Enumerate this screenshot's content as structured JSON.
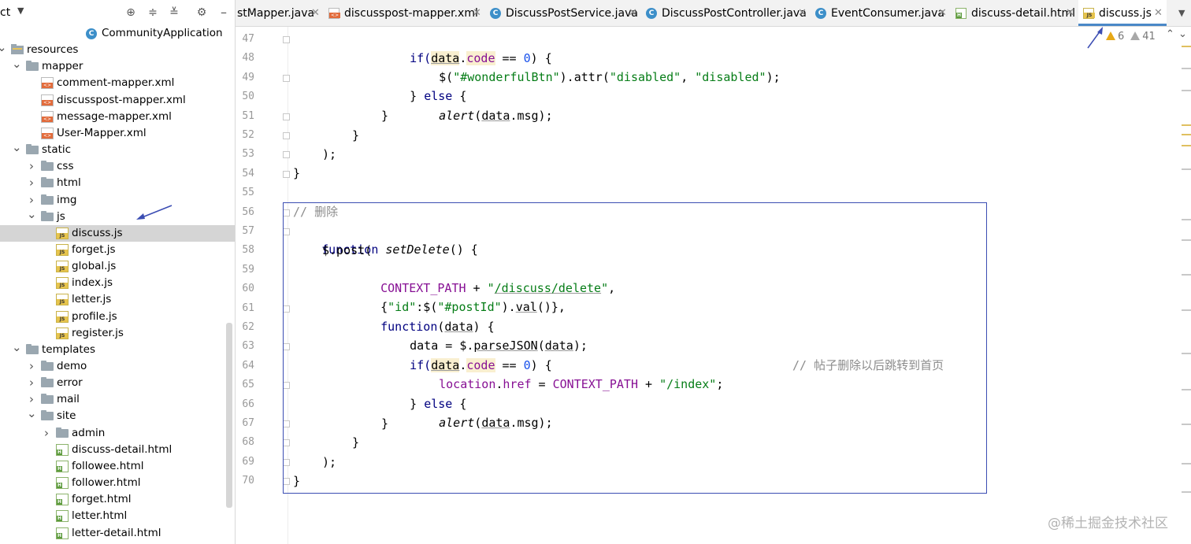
{
  "project_panel": {
    "title": "ct",
    "items": [
      {
        "label": "CommunityApplication",
        "type": "app",
        "depth": 5,
        "arrow": ""
      },
      {
        "label": "resources",
        "type": "resources",
        "depth": 0,
        "arrow": "v"
      },
      {
        "label": "mapper",
        "type": "folder",
        "depth": 1,
        "arrow": "v"
      },
      {
        "label": "comment-mapper.xml",
        "type": "xml",
        "depth": 2,
        "arrow": ""
      },
      {
        "label": "discusspost-mapper.xml",
        "type": "xml",
        "depth": 2,
        "arrow": ""
      },
      {
        "label": "message-mapper.xml",
        "type": "xml",
        "depth": 2,
        "arrow": ""
      },
      {
        "label": "User-Mapper.xml",
        "type": "xml",
        "depth": 2,
        "arrow": ""
      },
      {
        "label": "static",
        "type": "folder",
        "depth": 1,
        "arrow": "v"
      },
      {
        "label": "css",
        "type": "folder",
        "depth": 2,
        "arrow": ">"
      },
      {
        "label": "html",
        "type": "folder",
        "depth": 2,
        "arrow": ">"
      },
      {
        "label": "img",
        "type": "folder",
        "depth": 2,
        "arrow": ">"
      },
      {
        "label": "js",
        "type": "folder",
        "depth": 2,
        "arrow": "v"
      },
      {
        "label": "discuss.js",
        "type": "js",
        "depth": 3,
        "arrow": "",
        "selected": true
      },
      {
        "label": "forget.js",
        "type": "js",
        "depth": 3,
        "arrow": ""
      },
      {
        "label": "global.js",
        "type": "js",
        "depth": 3,
        "arrow": ""
      },
      {
        "label": "index.js",
        "type": "js",
        "depth": 3,
        "arrow": ""
      },
      {
        "label": "letter.js",
        "type": "js",
        "depth": 3,
        "arrow": ""
      },
      {
        "label": "profile.js",
        "type": "js",
        "depth": 3,
        "arrow": ""
      },
      {
        "label": "register.js",
        "type": "js",
        "depth": 3,
        "arrow": ""
      },
      {
        "label": "templates",
        "type": "folder",
        "depth": 1,
        "arrow": "v"
      },
      {
        "label": "demo",
        "type": "folder",
        "depth": 2,
        "arrow": ">"
      },
      {
        "label": "error",
        "type": "folder",
        "depth": 2,
        "arrow": ">"
      },
      {
        "label": "mail",
        "type": "folder",
        "depth": 2,
        "arrow": ">"
      },
      {
        "label": "site",
        "type": "folder",
        "depth": 2,
        "arrow": "v"
      },
      {
        "label": "admin",
        "type": "folder",
        "depth": 3,
        "arrow": ">"
      },
      {
        "label": "discuss-detail.html",
        "type": "html",
        "depth": 3,
        "arrow": ""
      },
      {
        "label": "followee.html",
        "type": "html",
        "depth": 3,
        "arrow": ""
      },
      {
        "label": "follower.html",
        "type": "html",
        "depth": 3,
        "arrow": ""
      },
      {
        "label": "forget.html",
        "type": "html",
        "depth": 3,
        "arrow": ""
      },
      {
        "label": "letter.html",
        "type": "html",
        "depth": 3,
        "arrow": ""
      },
      {
        "label": "letter-detail.html",
        "type": "html",
        "depth": 3,
        "arrow": ""
      }
    ]
  },
  "tabs": [
    {
      "label": "stMapper.java",
      "type": "none",
      "active": false
    },
    {
      "label": "discusspost-mapper.xml",
      "type": "xml",
      "active": false
    },
    {
      "label": "DiscussPostService.java",
      "type": "class",
      "active": false
    },
    {
      "label": "DiscussPostController.java",
      "type": "class",
      "active": false
    },
    {
      "label": "EventConsumer.java",
      "type": "class",
      "active": false
    },
    {
      "label": "discuss-detail.html",
      "type": "html",
      "active": false
    },
    {
      "label": "discuss.js",
      "type": "js",
      "active": true
    }
  ],
  "inspections": {
    "warnings": "6",
    "weak_warnings": "41"
  },
  "editor": {
    "line_numbers": [
      "47",
      "48",
      "49",
      "50",
      "51",
      "52",
      "53",
      "54",
      "55",
      "56",
      "57",
      "58",
      "59",
      "60",
      "61",
      "62",
      "63",
      "64",
      "65",
      "66",
      "67",
      "68",
      "69",
      "70"
    ],
    "lines": {
      "l47": {
        "if": "if(",
        "data": "data",
        "dot": ".",
        "code": "code",
        " eq": " == ",
        "zero": "0",
        ") {": ") {"
      },
      "l48": {
        "a": "$(",
        "s1": "\"#wonderfulBtn\"",
        "b": ").attr(",
        "s2": "\"disabled\"",
        "c": ", ",
        "s3": "\"disabled\"",
        "d": ");"
      },
      "l49": {
        "a": "} ",
        "b": "else",
        "c": " {"
      },
      "l50": {
        "a": "alert",
        "b": "(",
        "c": "data",
        "d": ".msg);"
      },
      "l51": {
        "a": "}"
      },
      "l52": {
        "a": "}"
      },
      "l53": {
        "a": ");"
      },
      "l54": {
        "a": "}"
      },
      "l56": {
        "a": "// 删除"
      },
      "l57": {
        "a": "function",
        "b": " ",
        "c": "setDelete",
        "d": "() {"
      },
      "l58": {
        "a": "$.post("
      },
      "l59": {
        "a": "CONTEXT_PATH",
        "b": " + ",
        "c": "\"",
        "d": "/discuss/delete",
        "e": "\"",
        "f": ","
      },
      "l60": {
        "a": "{",
        "b": "\"id\"",
        "c": ":$(",
        "d": "\"#postId\"",
        "e": ").",
        "f": "val",
        "g": "()},"
      },
      "l61": {
        "a": "function",
        "b": "(",
        "c": "data",
        "d": ") {"
      },
      "l62": {
        "a": "data = $.",
        "b": "parseJSON",
        "c": "(",
        "d": "data",
        "e": ");"
      },
      "l63": {
        "if": "if(",
        "data": "data",
        "dot": ".",
        "code": "code",
        " eq": " == ",
        "zero": "0",
        ") {": ") {"
      },
      "l64": {
        "a": "location",
        "b": ".",
        "c": "href",
        "d": " = ",
        "e": "CONTEXT_PATH",
        "f": " + ",
        "g": "\"/index\"",
        "h": ";",
        "cm": "// 帖子删除以后跳转到首页"
      },
      "l65": {
        "a": "} ",
        "b": "else",
        "c": " {"
      },
      "l66": {
        "a": "alert",
        "b": "(",
        "c": "data",
        "d": ".msg);"
      },
      "l67": {
        "a": "}"
      },
      "l68": {
        "a": "}"
      },
      "l69": {
        "a": ");"
      },
      "l70": {
        "a": "}"
      }
    }
  },
  "watermark": "@稀土掘金技术社区"
}
